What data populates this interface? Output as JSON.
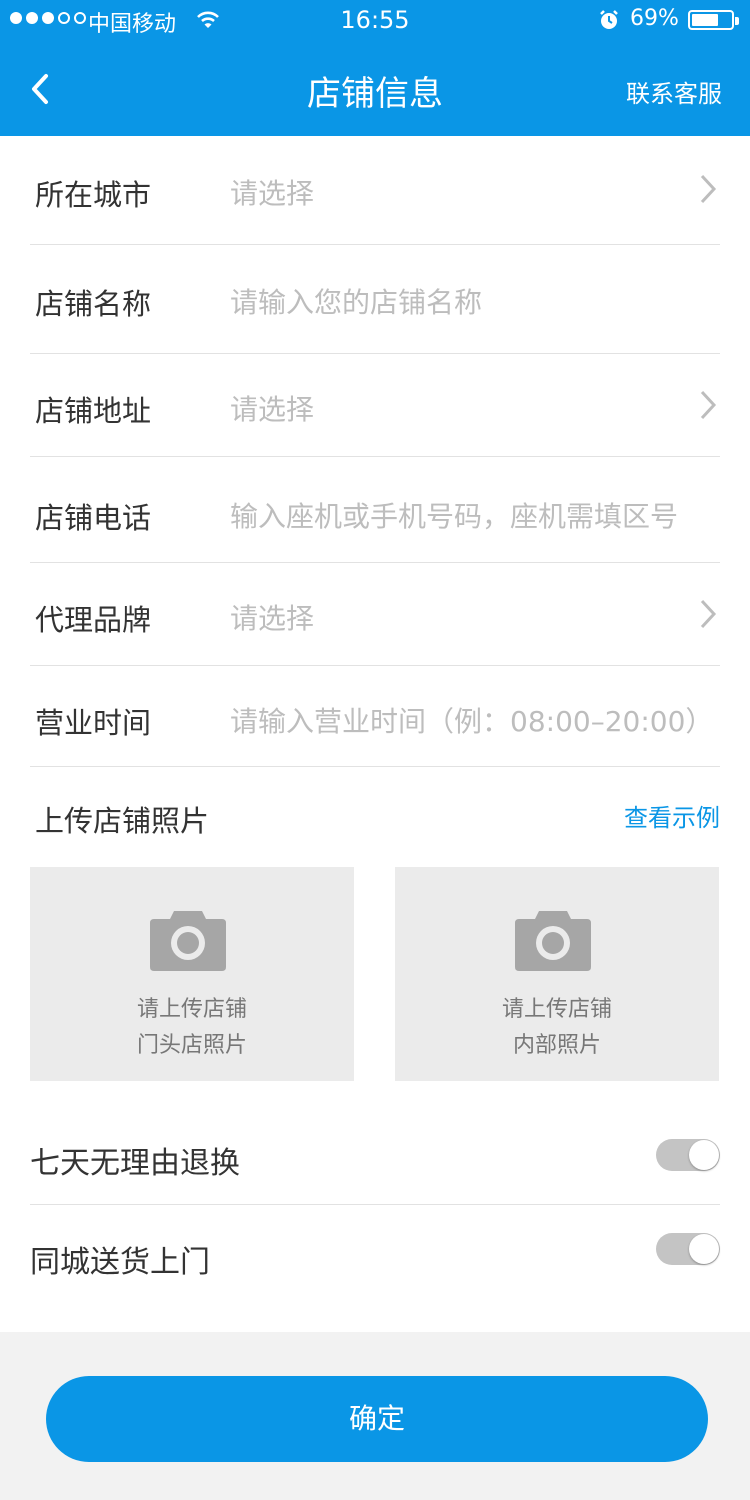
{
  "status": {
    "carrier": "中国移动",
    "time": "16:55",
    "battery": "69%"
  },
  "nav": {
    "title": "店铺信息",
    "right": "联系客服"
  },
  "form": {
    "city": {
      "label": "所在城市",
      "placeholder": "请选择"
    },
    "name": {
      "label": "店铺名称",
      "placeholder": "请输入您的店铺名称"
    },
    "address": {
      "label": "店铺地址",
      "placeholder": "请选择"
    },
    "phone": {
      "label": "店铺电话",
      "placeholder": "输入座机或手机号码，座机需填区号"
    },
    "brand": {
      "label": "代理品牌",
      "placeholder": "请选择"
    },
    "hours": {
      "label": "营业时间",
      "placeholder": "请输入营业时间（例：08:00–20:00）"
    }
  },
  "upload": {
    "title": "上传店铺照片",
    "example": "查看示例",
    "front": {
      "line1": "请上传店铺",
      "line2": "门头店照片"
    },
    "inside": {
      "line1": "请上传店铺",
      "line2": "内部照片"
    }
  },
  "toggles": {
    "return": {
      "label": "七天无理由退换",
      "on": false
    },
    "delivery": {
      "label": "同城送货上门",
      "on": false
    }
  },
  "confirm": "确定",
  "colors": {
    "accent": "#0a96e6",
    "toggle_off": "#c4c4c4"
  }
}
